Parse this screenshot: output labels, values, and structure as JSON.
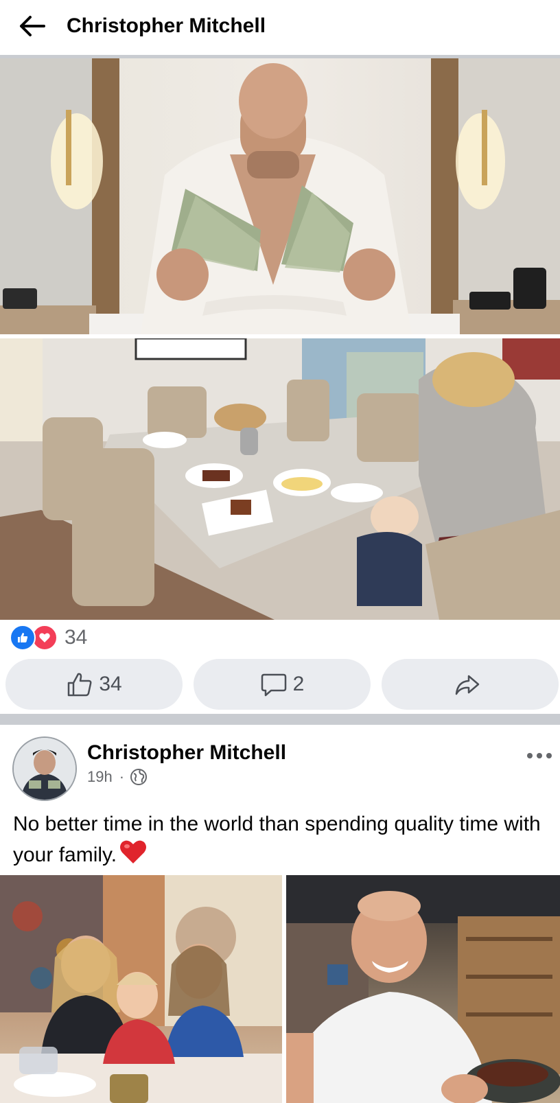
{
  "header": {
    "title": "Christopher Mitchell",
    "back_icon": "arrow-left-icon"
  },
  "post_top": {
    "photos": [
      {
        "icon": "photo-man-holding-money"
      },
      {
        "icon": "photo-family-breakfast-table"
      }
    ],
    "reactions": {
      "icons": [
        "like-icon",
        "love-icon"
      ],
      "count": "34"
    },
    "actions": {
      "like_count": "34",
      "comment_count": "2",
      "share_icon": "share-icon"
    }
  },
  "post_bottom": {
    "author": "Christopher Mitchell",
    "time": "19h",
    "separator": "·",
    "privacy_icon": "globe-icon",
    "more_icon": "more-dots-icon",
    "text": "No better time in the world than spending quality time with your family.",
    "emoji_icon": "red-heart-emoji",
    "photos": [
      {
        "icon": "photo-family-at-restaurant"
      },
      {
        "icon": "photo-man-smiling-with-dish"
      }
    ]
  },
  "colors": {
    "like_blue": "#1877f2",
    "love_red": "#f33e58",
    "divider": "#c9ccd1",
    "button_bg": "#eaecf0",
    "meta_text": "#65676b"
  }
}
